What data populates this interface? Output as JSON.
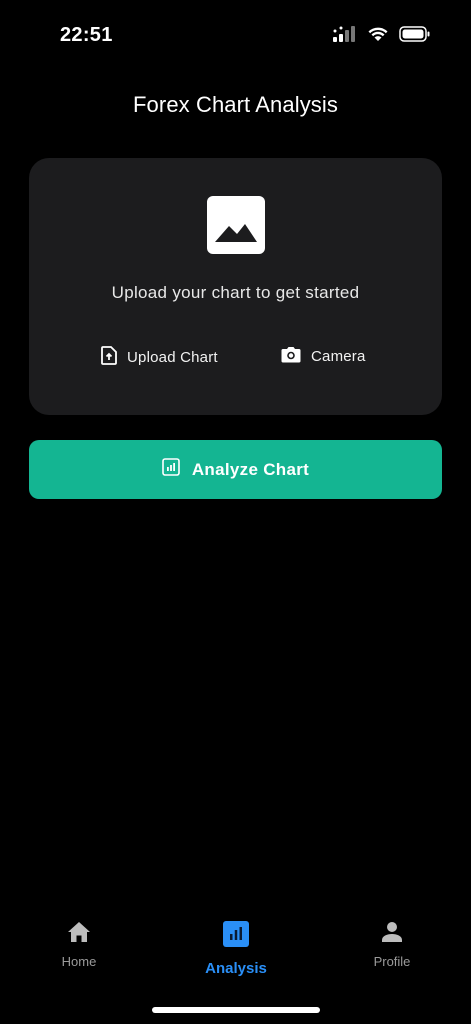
{
  "status_bar": {
    "time": "22:51",
    "icons": [
      "cellular-signal-icon",
      "wifi-icon",
      "battery-icon"
    ]
  },
  "header": {
    "title": "Forex Chart Analysis"
  },
  "upload_card": {
    "icon": "image-icon",
    "prompt": "Upload your chart to get started",
    "actions": [
      {
        "label": "Upload Chart",
        "icon": "file-upload-icon"
      },
      {
        "label": "Camera",
        "icon": "camera-icon"
      }
    ]
  },
  "analyze_button": {
    "label": "Analyze Chart",
    "icon": "chart-icon",
    "color": "#14b592"
  },
  "bottom_nav": {
    "items": [
      {
        "label": "Home",
        "icon": "home-icon",
        "active": false
      },
      {
        "label": "Analysis",
        "icon": "analytics-icon",
        "active": true
      },
      {
        "label": "Profile",
        "icon": "person-icon",
        "active": false
      }
    ],
    "active_color": "#2a8ff7",
    "inactive_color": "#9a9a9a"
  }
}
